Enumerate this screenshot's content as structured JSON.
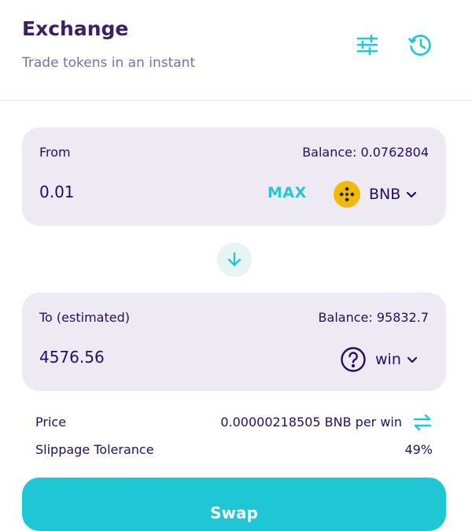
{
  "header": {
    "title": "Exchange",
    "subtitle": "Trade tokens in an instant",
    "settings_icon": "sliders-icon",
    "history_icon": "history-icon"
  },
  "from": {
    "label": "From",
    "balance": "Balance: 0.0762804",
    "amount": "0.01",
    "max_label": "MAX",
    "token": {
      "symbol": "BNB",
      "icon": "bnb-logo-icon"
    }
  },
  "switch_icon": "arrow-down-icon",
  "to": {
    "label": "To (estimated)",
    "balance": "Balance: 95832.7",
    "amount": "4576.56",
    "token": {
      "symbol": "win",
      "icon": "question-circle-icon"
    }
  },
  "info": {
    "price_label": "Price",
    "price_value": "0.00000218505 BNB per win",
    "slippage_label": "Slippage Tolerance",
    "slippage_value": "49%"
  },
  "swap_button": "Swap",
  "colors": {
    "accent": "#1fc7d4",
    "text": "#280d5f",
    "title": "#3b2163",
    "subtle": "#7a6eaa",
    "panel": "#eeeaf4",
    "bnb": "#f0b90b"
  }
}
